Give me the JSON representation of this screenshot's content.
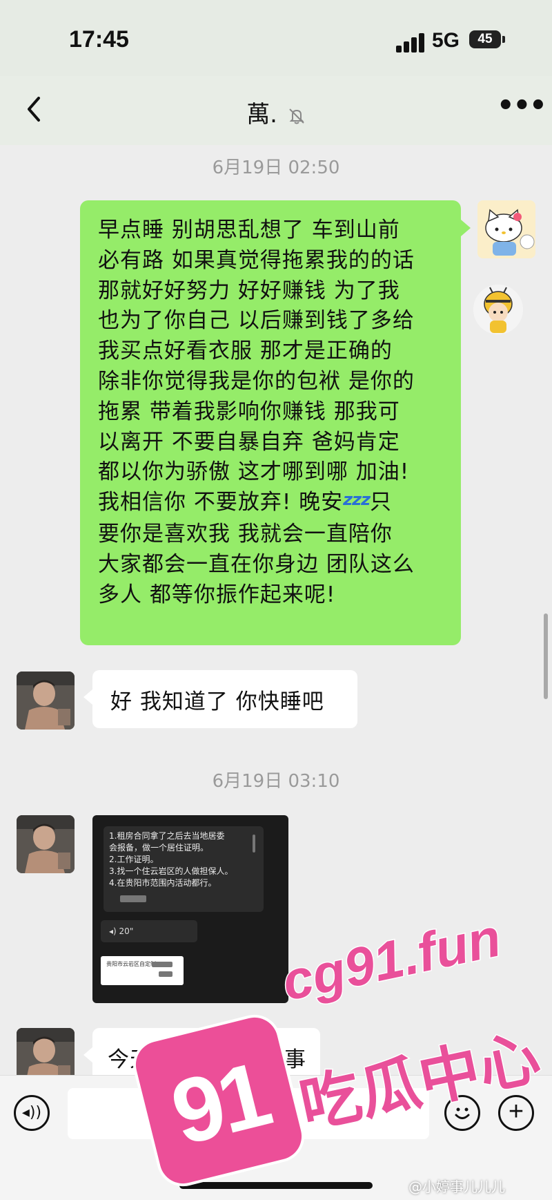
{
  "status_bar": {
    "time": "17:45",
    "network": "5G",
    "battery": "45"
  },
  "header": {
    "back_icon": "chevron-left-icon",
    "title": "萬.",
    "mute_icon": "bell-slash-icon",
    "more_label": "•••"
  },
  "timestamps": [
    "6月19日 02:50",
    "6月19日 03:10"
  ],
  "messages": {
    "outgoing_1_lines": [
      "早点睡 别胡思乱想了 车到山前",
      "必有路 如果真觉得拖累我的的话",
      "那就好好努力 好好赚钱 为了我",
      "也为了你自己 以后赚到钱了多给",
      "我买点好看衣服 那才是正确的",
      "除非你觉得我是你的包袱 是你的",
      "拖累 带着我影响你赚钱 那我可",
      "以离开 不要自暴自弃 爸妈肯定",
      "都以你为骄傲 这才哪到哪 加油!",
      "我相信你 不要放弃! 晚安",
      "要你是喜欢我 我就会一直陪你",
      "大家都会一直在你身边 团队这么",
      "多人 都等你振作起来呢!"
    ],
    "outgoing_1_line10_tail": "只",
    "zzz_emoji": "zzz",
    "incoming_1": "好 我知道了 你快睡吧",
    "incoming_image": {
      "lines": [
        "1.租房合同拿了之后去当地居委",
        "会报备，做一个居住证明。",
        "2.工作证明。",
        "3.找一个住云岩区的人做担保人。",
        "4.在贵阳市范围内活动都行。"
      ],
      "voice_label": "20\"",
      "card_text": "贵阳市云岩区自定制"
    },
    "incoming_2": "今天睡醒了要去办事"
  },
  "input_bar": {
    "voice_icon": "voice-icon",
    "emoji_icon": "emoji-icon",
    "plus_icon": "plus-icon"
  },
  "watermark": {
    "site": "cg91.fun",
    "name": "吃瓜中心",
    "badge": "91"
  },
  "credit": "@小婷事儿儿儿"
}
